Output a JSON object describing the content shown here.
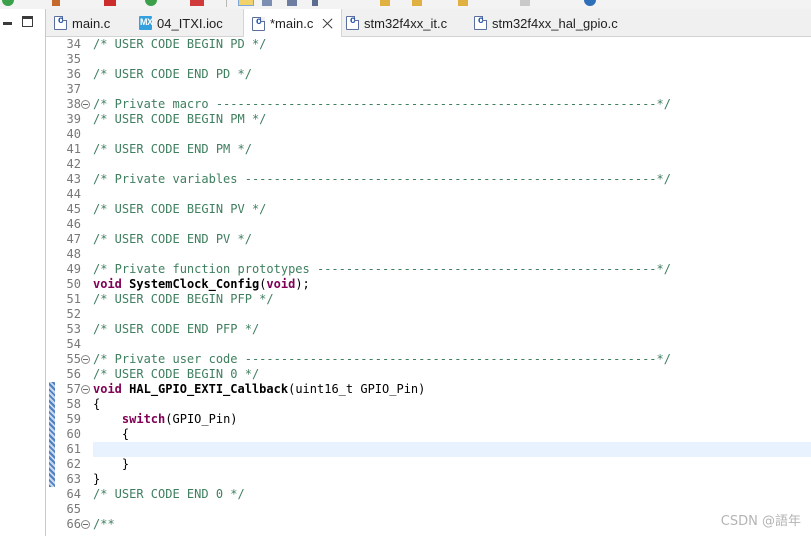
{
  "tabs": [
    {
      "label": "main.c",
      "icon": "c-file-icon",
      "active": false
    },
    {
      "label": "04_ITXI.ioc",
      "icon": "stm32cubemx-file-icon",
      "active": false
    },
    {
      "label": "*main.c",
      "icon": "c-file-icon",
      "active": true
    },
    {
      "label": "stm32f4xx_it.c",
      "icon": "c-file-icon",
      "active": false
    },
    {
      "label": "stm32f4xx_hal_gpio.c",
      "icon": "c-file-icon",
      "active": false
    }
  ],
  "editor": {
    "line_numbers": [
      "34",
      "35",
      "36",
      "37",
      "38",
      "39",
      "40",
      "41",
      "42",
      "43",
      "44",
      "45",
      "46",
      "47",
      "48",
      "49",
      "50",
      "51",
      "52",
      "53",
      "54",
      "55",
      "56",
      "57",
      "58",
      "59",
      "60",
      "61",
      "62",
      "63",
      "64",
      "65",
      "66"
    ],
    "lines": {
      "l34": "/* USER CODE BEGIN PD */",
      "l36": "/* USER CODE END PD */",
      "l38": "/* Private macro -------------------------------------------------------------*/",
      "l39": "/* USER CODE BEGIN PM */",
      "l41": "/* USER CODE END PM */",
      "l43": "/* Private variables ---------------------------------------------------------*/",
      "l45": "/* USER CODE BEGIN PV */",
      "l47": "/* USER CODE END PV */",
      "l49": "/* Private function prototypes -----------------------------------------------*/",
      "l50_kw": "void",
      "l50_name": "SystemClock_Config",
      "l50_open": "(",
      "l50_arg": "void",
      "l50_close": ");",
      "l51": "/* USER CODE BEGIN PFP */",
      "l53": "/* USER CODE END PFP */",
      "l55": "/* Private user code ---------------------------------------------------------*/",
      "l56": "/* USER CODE BEGIN 0 */",
      "l57_kw": "void",
      "l57_name": "HAL_GPIO_EXTI_Callback",
      "l57_rest": "(uint16_t GPIO_Pin)",
      "l58": "{",
      "l59_indent": "    ",
      "l59_kw": "switch",
      "l59_rest": "(GPIO_Pin)",
      "l60": "    {",
      "l62": "    }",
      "l63": "}",
      "l64": "/* USER CODE END 0 */",
      "l66": "/**"
    }
  },
  "watermark": "CSDN @語年",
  "colors": {
    "comment": "#3f7f5f",
    "keyword": "#7f0055",
    "line_number": "#787878",
    "current_line": "#e8f2fe",
    "change_ruler": "#4f80c0"
  }
}
